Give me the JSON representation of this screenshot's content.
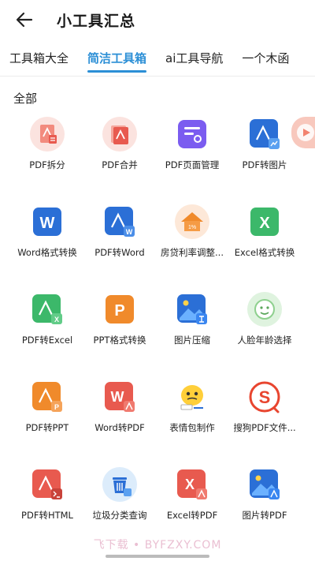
{
  "header": {
    "title": "小工具汇总",
    "back_icon": "arrow-left-icon"
  },
  "tabs": [
    {
      "label": "工具箱大全",
      "active": false
    },
    {
      "label": "简洁工具箱",
      "active": true
    },
    {
      "label": "ai工具导航",
      "active": false
    },
    {
      "label": "一个木函",
      "active": false
    }
  ],
  "section_title": "全部",
  "tools": [
    {
      "label": "PDF拆分",
      "icon": "pdf-split-icon"
    },
    {
      "label": "PDF合并",
      "icon": "pdf-merge-icon"
    },
    {
      "label": "PDF页面管理",
      "icon": "pdf-page-manage-icon"
    },
    {
      "label": "PDF转图片",
      "icon": "pdf-to-image-icon"
    },
    {
      "label": "Word格式转换",
      "icon": "word-icon"
    },
    {
      "label": "PDF转Word",
      "icon": "pdf-to-word-icon"
    },
    {
      "label": "房贷利率调整...",
      "icon": "house-rate-icon"
    },
    {
      "label": "Excel格式转换",
      "icon": "excel-icon"
    },
    {
      "label": "PDF转Excel",
      "icon": "pdf-to-excel-icon"
    },
    {
      "label": "PPT格式转换",
      "icon": "ppt-icon"
    },
    {
      "label": "图片压缩",
      "icon": "image-compress-icon"
    },
    {
      "label": "人脸年龄选择",
      "icon": "face-age-icon"
    },
    {
      "label": "PDF转PPT",
      "icon": "pdf-to-ppt-icon"
    },
    {
      "label": "Word转PDF",
      "icon": "word-to-pdf-icon"
    },
    {
      "label": "表情包制作",
      "icon": "emoji-maker-icon"
    },
    {
      "label": "搜狗PDF文件...",
      "icon": "sogou-pdf-icon"
    },
    {
      "label": "PDF转HTML",
      "icon": "pdf-to-html-icon"
    },
    {
      "label": "垃圾分类查询",
      "icon": "trash-sort-icon"
    },
    {
      "label": "Excel转PDF",
      "icon": "excel-to-pdf-icon"
    },
    {
      "label": "图片转PDF",
      "icon": "image-to-pdf-icon"
    }
  ],
  "floating_icon": "video-play-icon",
  "watermark": "飞下载 • BYFZXY.COM",
  "colors": {
    "accent": "#2c8fd6",
    "pdf_red": "#e85a4f",
    "word_blue": "#2b6fd6",
    "excel_green": "#3cb86a",
    "ppt_orange": "#f08a2b",
    "purple": "#7b5cf0"
  }
}
